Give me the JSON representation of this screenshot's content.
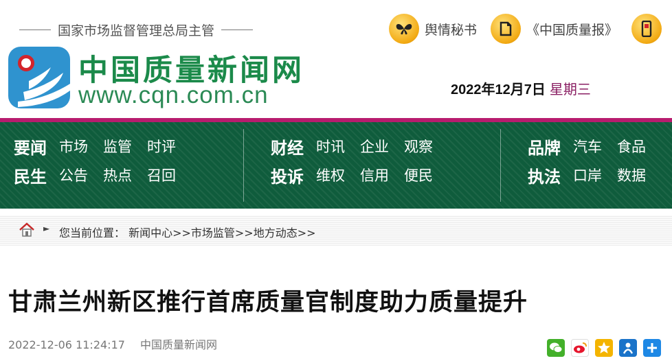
{
  "header": {
    "supervisor": "国家市场监督管理总局主管",
    "site_name": "中国质量新闻网",
    "site_url": "www.cqn.com.cn",
    "top_links": [
      {
        "label": "舆情秘书",
        "icon": "butterfly-icon"
      },
      {
        "label": "《中国质量报》",
        "icon": "newspaper-icon"
      },
      {
        "label": "",
        "icon": "mobile-phone-icon"
      }
    ],
    "date": "2022年12月7日",
    "weekday": "星期三"
  },
  "nav": {
    "groups": [
      {
        "rows": [
          {
            "category": "要闻",
            "links": [
              "市场",
              "监管",
              "时评"
            ]
          },
          {
            "category": "民生",
            "links": [
              "公告",
              "热点",
              "召回"
            ]
          }
        ]
      },
      {
        "rows": [
          {
            "category": "财经",
            "links": [
              "时讯",
              "企业",
              "观察"
            ]
          },
          {
            "category": "投诉",
            "links": [
              "维权",
              "信用",
              "便民"
            ]
          }
        ]
      },
      {
        "rows": [
          {
            "category": "品牌",
            "links": [
              "汽车",
              "食品"
            ]
          },
          {
            "category": "执法",
            "links": [
              "口岸",
              "数据"
            ]
          }
        ]
      }
    ]
  },
  "breadcrumb": {
    "text": "您当前位置： 新闻中心>>市场监管>>地方动态>>"
  },
  "article": {
    "title": "甘肃兰州新区推行首席质量官制度助力质量提升",
    "timestamp": "2022-12-06 11:24:17",
    "source": "中国质量新闻网"
  },
  "share_icons": [
    {
      "icon": "wechat-share-icon",
      "color": "#43b02a"
    },
    {
      "icon": "weibo-share-icon",
      "color": "#e6162d"
    },
    {
      "icon": "qzone-share-icon",
      "color": "#f4b400"
    },
    {
      "icon": "renren-share-icon",
      "color": "#1a73c9"
    },
    {
      "icon": "more-share-icon",
      "color": "#1e88e5"
    }
  ],
  "colors": {
    "nav_bg": "#0f5c3c",
    "nav_accent_line": "#b81c6e",
    "brand_green": "#1b8a4a",
    "weekday": "#8a1f63"
  }
}
